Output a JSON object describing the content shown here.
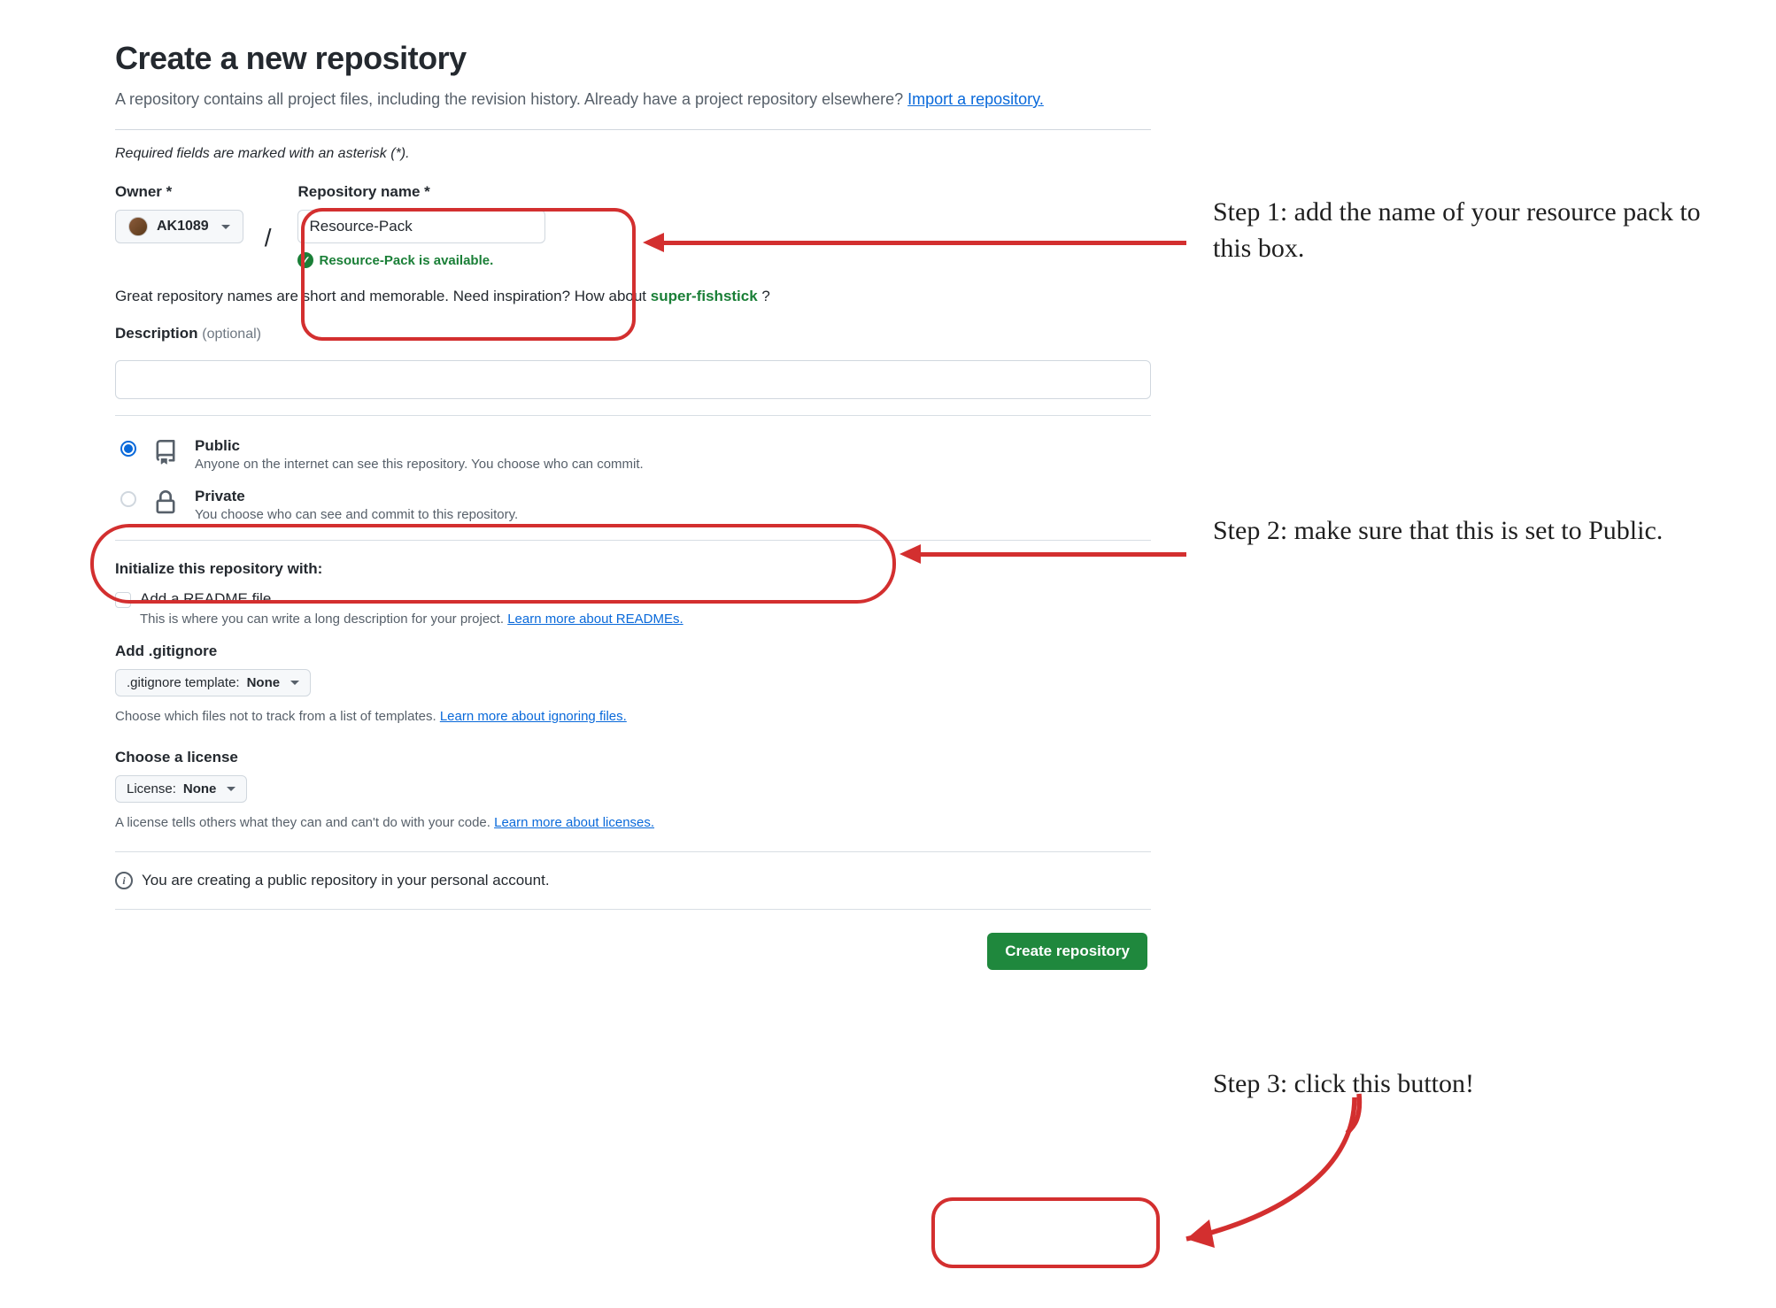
{
  "header": {
    "title": "Create a new repository",
    "subhead_text": "A repository contains all project files, including the revision history. Already have a project repository elsewhere? ",
    "import_link": "Import a repository.",
    "required_note": "Required fields are marked with an asterisk (*)."
  },
  "owner": {
    "label": "Owner *",
    "name": "AK1089"
  },
  "repo": {
    "label": "Repository name *",
    "value": "Resource-Pack",
    "availability_msg": "Resource-Pack is available."
  },
  "naming_hint": {
    "prefix": "Great repository names are short and memorable. Need inspiration? How about ",
    "suggestion": "super-fishstick",
    "suffix": " ?"
  },
  "description": {
    "label": "Description",
    "optional": "(optional)",
    "value": ""
  },
  "visibility": {
    "public": {
      "title": "Public",
      "desc": "Anyone on the internet can see this repository. You choose who can commit."
    },
    "private": {
      "title": "Private",
      "desc": "You choose who can see and commit to this repository."
    }
  },
  "init": {
    "heading": "Initialize this repository with:",
    "readme_label": "Add a README file",
    "readme_desc": "This is where you can write a long description for your project. ",
    "readme_link": "Learn more about READMEs."
  },
  "gitignore": {
    "heading": "Add .gitignore",
    "button_prefix": ".gitignore template: ",
    "button_value": "None",
    "note": "Choose which files not to track from a list of templates. ",
    "link": "Learn more about ignoring files."
  },
  "license": {
    "heading": "Choose a license",
    "button_prefix": "License: ",
    "button_value": "None",
    "note": "A license tells others what they can and can't do with your code. ",
    "link": "Learn more about licenses."
  },
  "info_banner": "You are creating a public repository in your personal account.",
  "create_button": "Create repository",
  "annotations": {
    "step1": "Step 1: add the name of your resource pack to this box.",
    "step2": "Step 2: make sure that this is set to Public.",
    "step3": "Step 3: click this button!"
  }
}
